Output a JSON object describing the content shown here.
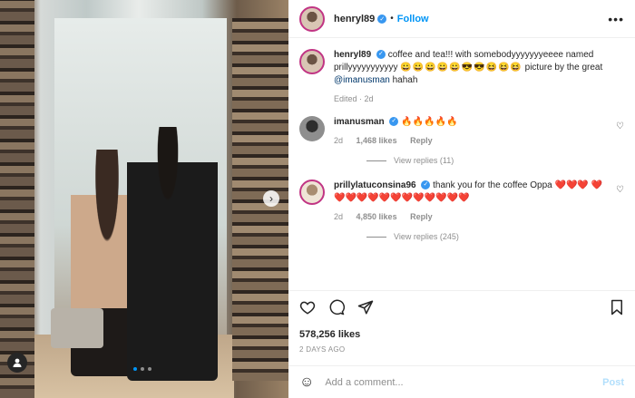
{
  "post": {
    "username": "henryl89",
    "follow_label": "Follow",
    "more_label": "•••",
    "separator": "•"
  },
  "caption": {
    "username": "henryl89",
    "text": "coffee and tea!!! with somebodyyyyyyyeeee named prillyyyyyyyyyyy",
    "emojis": "😀😀😀😀😀😎😎😆😆😆",
    "text_after": "picture by the great",
    "mention": "@imanusman",
    "trailing": "hahah",
    "meta": "Edited · 2d"
  },
  "comments": [
    {
      "username": "imanusman",
      "text": "🔥🔥🔥🔥🔥",
      "time": "2d",
      "likes": "1,468 likes",
      "reply": "Reply",
      "view_replies": "View replies (11)"
    },
    {
      "username": "prillylatuconsina96",
      "text": "thank you for the coffee Oppa ❤️❤️❤️ ❤️❤️❤️❤️❤️❤️❤️❤️❤️❤️❤️❤️❤️",
      "time": "2d",
      "likes": "4,850 likes",
      "reply": "Reply",
      "view_replies": "View replies (245)"
    }
  ],
  "actions": {
    "likes": "578,256 likes",
    "date": "2 DAYS AGO"
  },
  "composer": {
    "placeholder": "Add a comment...",
    "post_label": "Post"
  },
  "carousel": {
    "total": 3,
    "active_index": 0
  }
}
